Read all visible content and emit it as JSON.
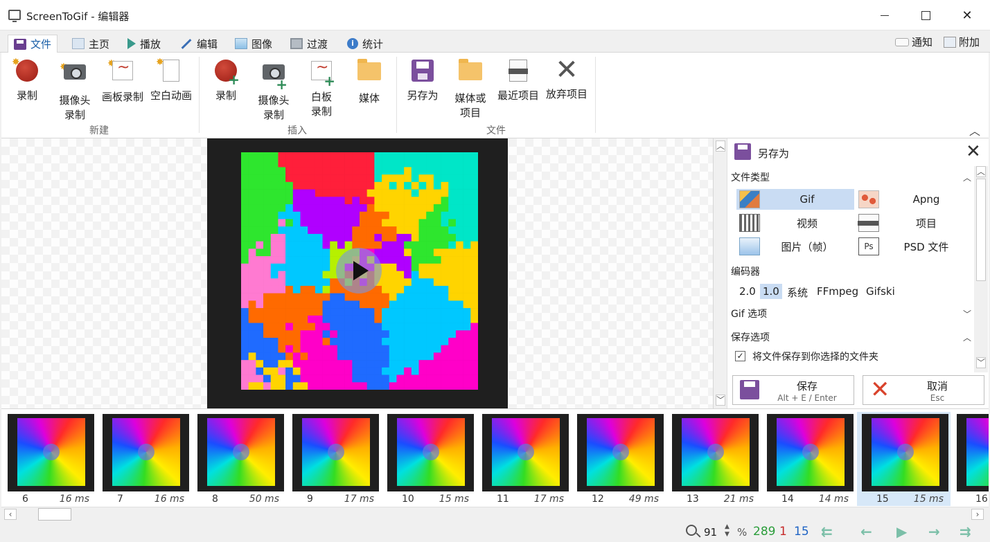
{
  "window": {
    "title": "ScreenToGif - 编辑器"
  },
  "tabs": [
    {
      "label": "文件",
      "icon": "save-icon",
      "active": true
    },
    {
      "label": "主页",
      "icon": "home-icon"
    },
    {
      "label": "播放",
      "icon": "play-icon"
    },
    {
      "label": "编辑",
      "icon": "pen-icon"
    },
    {
      "label": "图像",
      "icon": "image-icon"
    },
    {
      "label": "过渡",
      "icon": "transition-icon"
    },
    {
      "label": "统计",
      "icon": "info-icon"
    }
  ],
  "tabs_right": {
    "notify": "通知",
    "extras": "附加"
  },
  "ribbon": {
    "new_group": {
      "label": "新建",
      "items": [
        {
          "label": "录制"
        },
        {
          "label": "摄像头\n录制"
        },
        {
          "label": "画板录制"
        },
        {
          "label": "空白动画"
        }
      ]
    },
    "insert_group": {
      "label": "插入",
      "items": [
        {
          "label": "录制"
        },
        {
          "label": "摄像头\n录制"
        },
        {
          "label": "白板\n录制"
        },
        {
          "label": "媒体"
        }
      ]
    },
    "file_group": {
      "label": "文件",
      "items": [
        {
          "label": "另存为"
        },
        {
          "label": "媒体或\n项目"
        },
        {
          "label": "最近项目"
        },
        {
          "label": "放弃项目"
        }
      ]
    }
  },
  "save_panel": {
    "title": "另存为",
    "file_type_header": "文件类型",
    "file_types": [
      {
        "label": "Gif",
        "icon": "gif-icon",
        "selected": true
      },
      {
        "label": "Apng",
        "icon": "apng-icon"
      },
      {
        "label": "视频",
        "icon": "video-icon"
      },
      {
        "label": "项目",
        "icon": "project-icon"
      },
      {
        "label": "图片（帧）",
        "icon": "picture-icon"
      },
      {
        "label": "PSD 文件",
        "icon": "psd-icon"
      }
    ],
    "encoder_header": "编码器",
    "encoders": [
      {
        "label": "2.0"
      },
      {
        "label": "1.0",
        "selected": true
      },
      {
        "label": "系统"
      },
      {
        "label": "FFmpeg"
      },
      {
        "label": "Gifski"
      }
    ],
    "gif_options_header": "Gif 选项",
    "save_options_header": "保存选项",
    "save_to_folder": "将文件保存到你选择的文件夹",
    "save_button": {
      "label": "保存",
      "shortcut": "Alt + E / Enter"
    },
    "cancel_button": {
      "label": "取消",
      "shortcut": "Esc"
    }
  },
  "frames": [
    {
      "number": "6",
      "delay": "16 ms"
    },
    {
      "number": "7",
      "delay": "16 ms"
    },
    {
      "number": "8",
      "delay": "50 ms"
    },
    {
      "number": "9",
      "delay": "17 ms"
    },
    {
      "number": "10",
      "delay": "15 ms"
    },
    {
      "number": "11",
      "delay": "17 ms"
    },
    {
      "number": "12",
      "delay": "49 ms"
    },
    {
      "number": "13",
      "delay": "21 ms"
    },
    {
      "number": "14",
      "delay": "14 ms"
    },
    {
      "number": "15",
      "delay": "15 ms",
      "selected": true
    },
    {
      "number": "16",
      "delay": ""
    }
  ],
  "status": {
    "zoom": "91",
    "zoom_unit": "%",
    "total_frames": "289",
    "selected_count": "1",
    "current_frame": "15"
  },
  "colors": {
    "accent": "#1a5fa8",
    "save_purple": "#7b4f9d",
    "total_green": "#2a9d3a",
    "selected_red": "#c62828",
    "current_blue": "#1e63c4",
    "selection_bg": "#c9dcf3"
  }
}
